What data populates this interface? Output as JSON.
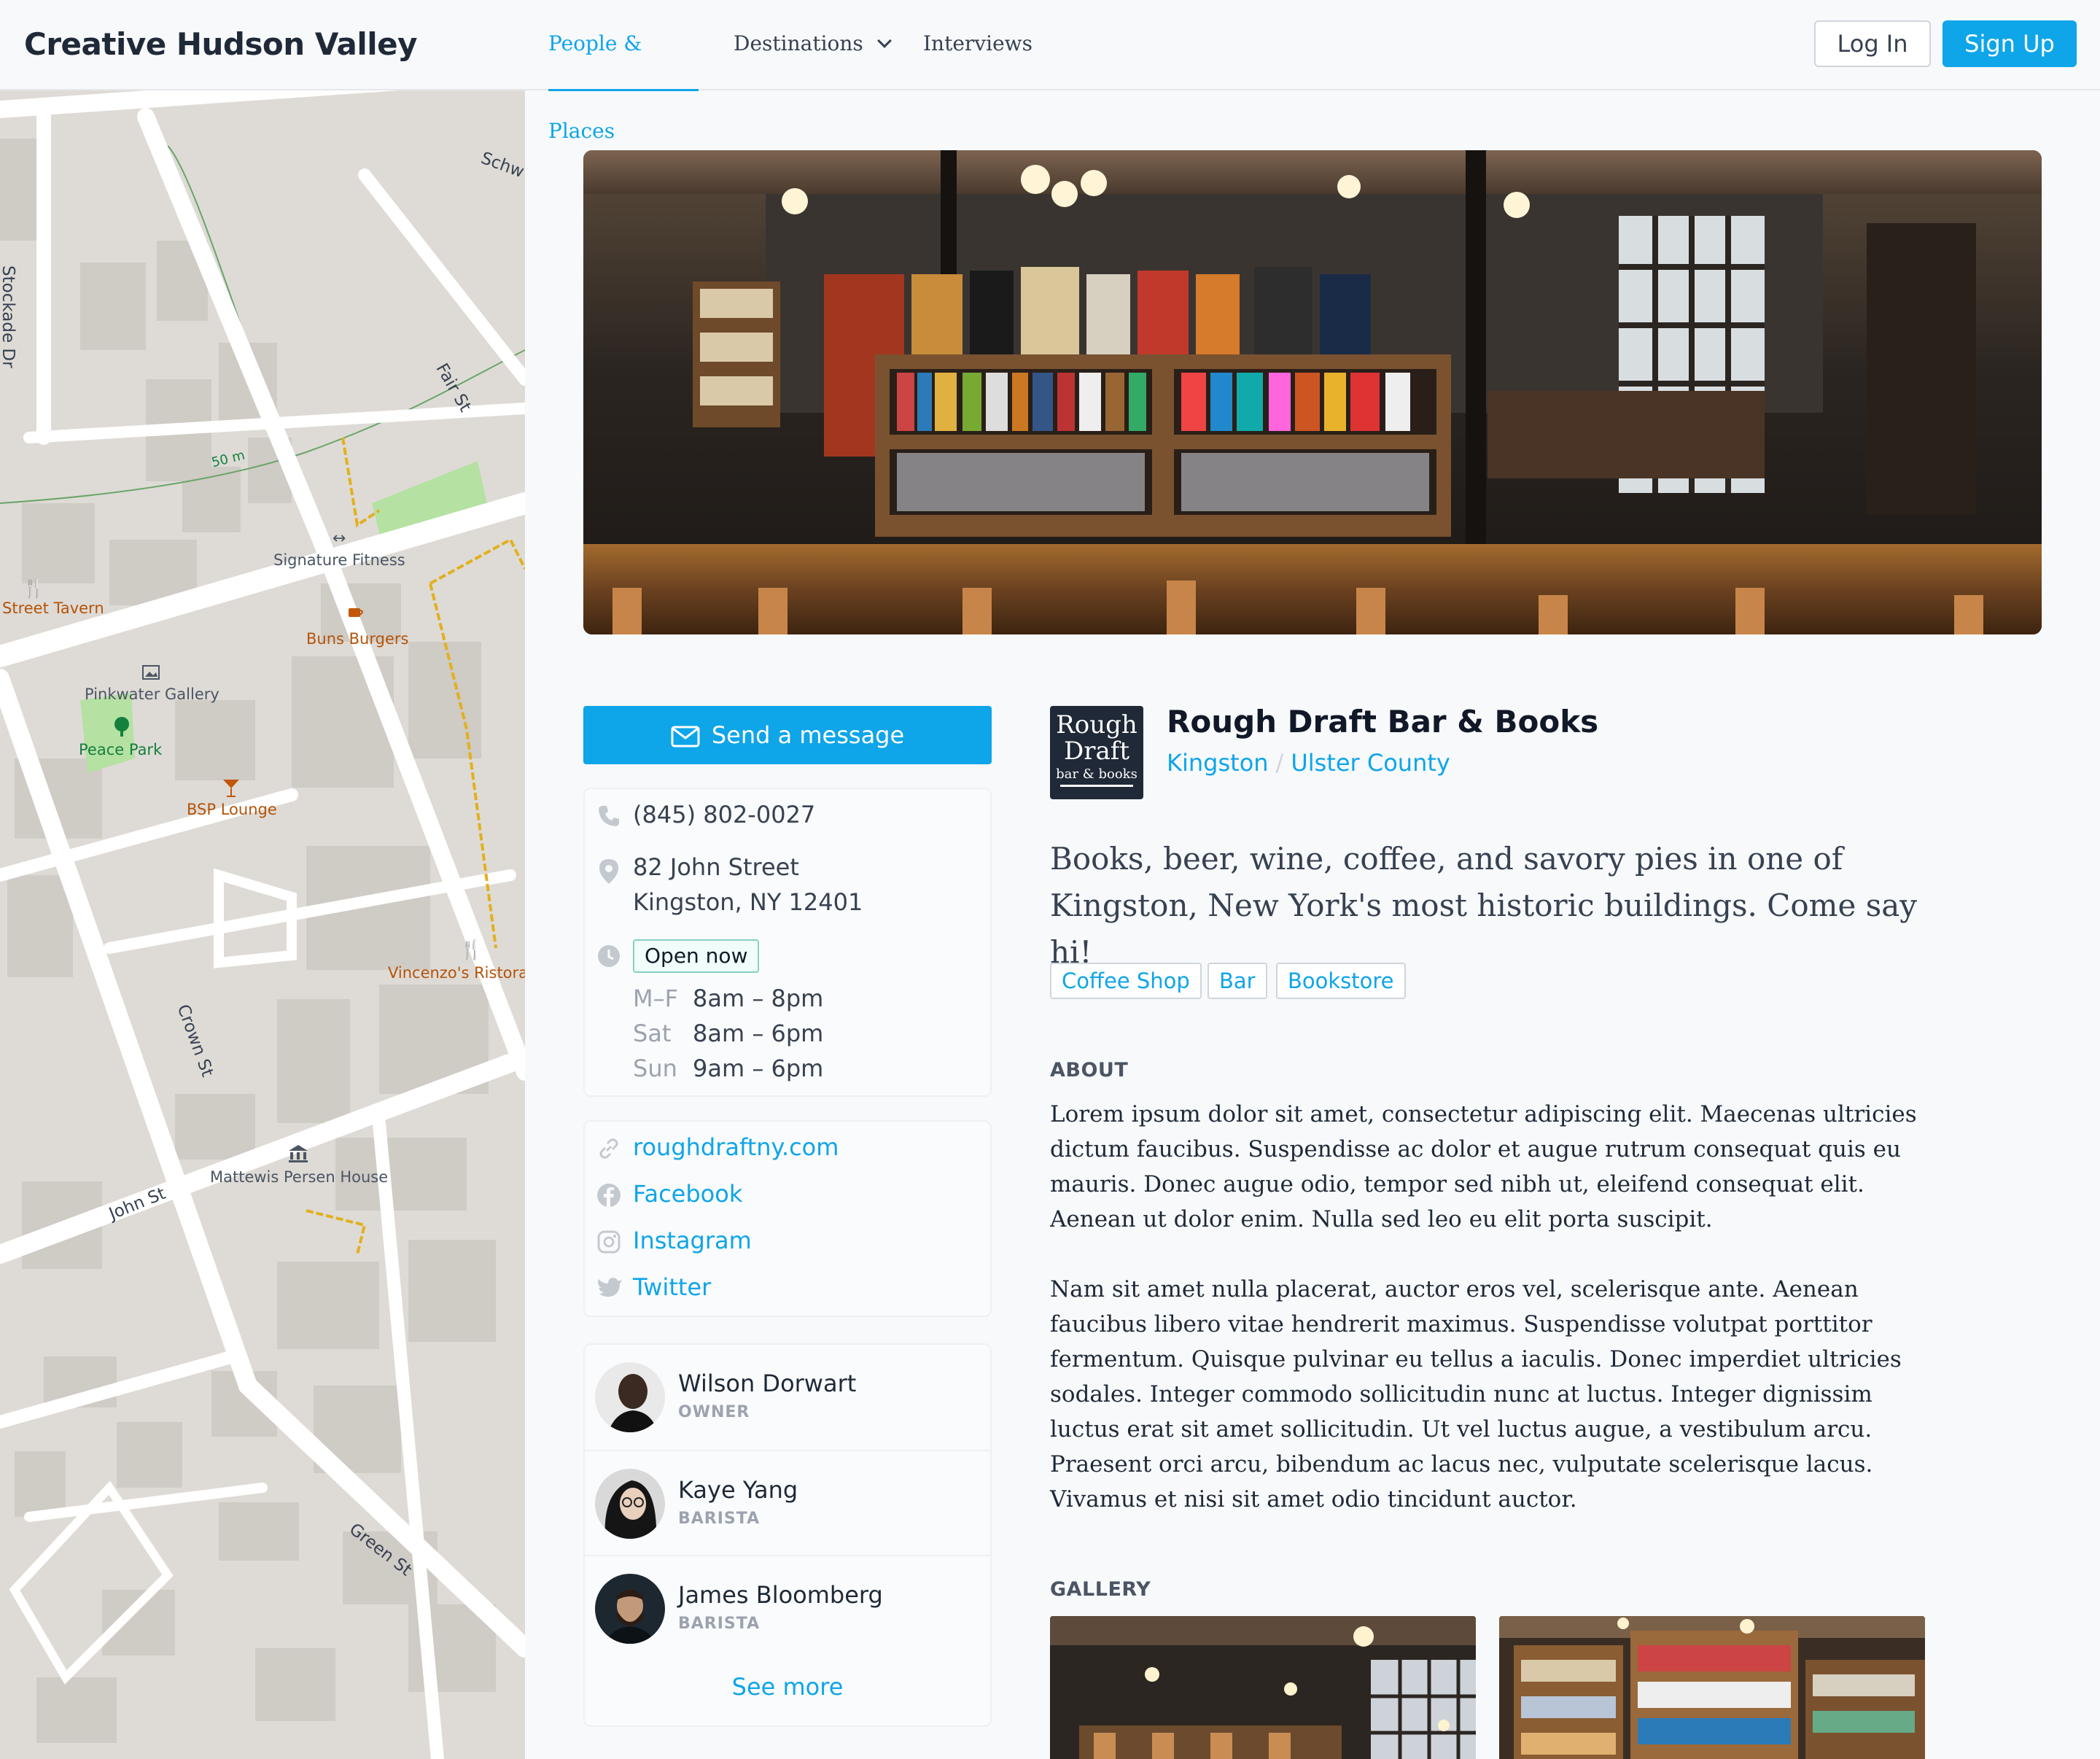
{
  "header": {
    "app_title": "Creative Hudson Valley",
    "nav": {
      "people": "People & Places",
      "destinations": "Destinations",
      "interviews": "Interviews"
    },
    "login": "Log In",
    "signup": "Sign Up"
  },
  "map": {
    "streets": [
      "Stockade Dr",
      "Fair St",
      "Schw",
      "Crown St",
      "John St",
      "Green St"
    ],
    "pois": [
      "Signature Fitness",
      "Street Tavern",
      "Buns Burgers",
      "Pinkwater Gallery",
      "Peace Park",
      "BSP Lounge",
      "Vincenzo's Ristora",
      "Mattewis Persen House"
    ],
    "scale": "50 m"
  },
  "actions": {
    "send_message": "Send a message"
  },
  "contact": {
    "phone": "(845) 802-0027",
    "address_line1": "82 John Street",
    "address_line2": "Kingston, NY 12401",
    "open_status": "Open now",
    "hours": [
      {
        "day": "M–F",
        "time": "8am – 8pm"
      },
      {
        "day": "Sat",
        "time": "8am – 6pm"
      },
      {
        "day": "Sun",
        "time": "9am – 6pm"
      }
    ]
  },
  "links": {
    "website": "roughdraftny.com",
    "facebook": "Facebook",
    "instagram": "Instagram",
    "twitter": "Twitter"
  },
  "people": [
    {
      "name": "Wilson Dorwart",
      "role": "OWNER"
    },
    {
      "name": "Kaye Yang",
      "role": "BARISTA"
    },
    {
      "name": "James Bloomberg",
      "role": "BARISTA"
    }
  ],
  "see_more": "See more",
  "business": {
    "logo": {
      "line1": "Rough",
      "line2": "Draft",
      "line3": "bar & books"
    },
    "name": "Rough Draft Bar & Books",
    "city": "Kingston",
    "separator": "/",
    "county": "Ulster County",
    "tagline": "Books, beer, wine, coffee, and savory pies in one of Kingston, New York's most historic buildings. Come say hi!",
    "tags": [
      "Coffee Shop",
      "Bar",
      "Bookstore"
    ]
  },
  "about": {
    "heading": "ABOUT",
    "paragraphs": [
      "Lorem ipsum dolor sit amet, consectetur adipiscing elit. Maecenas ultricies dictum faucibus. Suspendisse ac dolor et augue rutrum consequat quis eu mauris. Donec augue odio, tempor sed nibh ut, eleifend consequat elit. Aenean ut dolor enim. Nulla sed leo eu elit porta suscipit.",
      "Nam sit amet nulla placerat, auctor eros vel, scelerisque ante. Aenean faucibus libero vitae hendrerit maximus. Suspendisse volutpat porttitor fermentum. Quisque pulvinar eu tellus a iaculis. Donec imperdiet ultricies sodales. Integer commodo sollicitudin nunc at luctus. Integer dignissim luctus erat sit amet sollicitudin. Ut vel luctus augue, a vestibulum arcu. Praesent orci arcu, bibendum ac lacus nec, vulputate scelerisque lacus. Vivamus et nisi sit amet odio tincidunt auctor."
    ]
  },
  "gallery": {
    "heading": "GALLERY"
  },
  "colors": {
    "accent": "#0ea5e9",
    "text": "#1f2937",
    "muted": "#9ca3af",
    "open_badge_border": "#86d1c1"
  },
  "icons": [
    "phone-icon",
    "map-pin-icon",
    "clock-icon",
    "link-icon",
    "facebook-icon",
    "instagram-icon",
    "twitter-icon",
    "envelope-icon",
    "chevron-down-icon"
  ]
}
